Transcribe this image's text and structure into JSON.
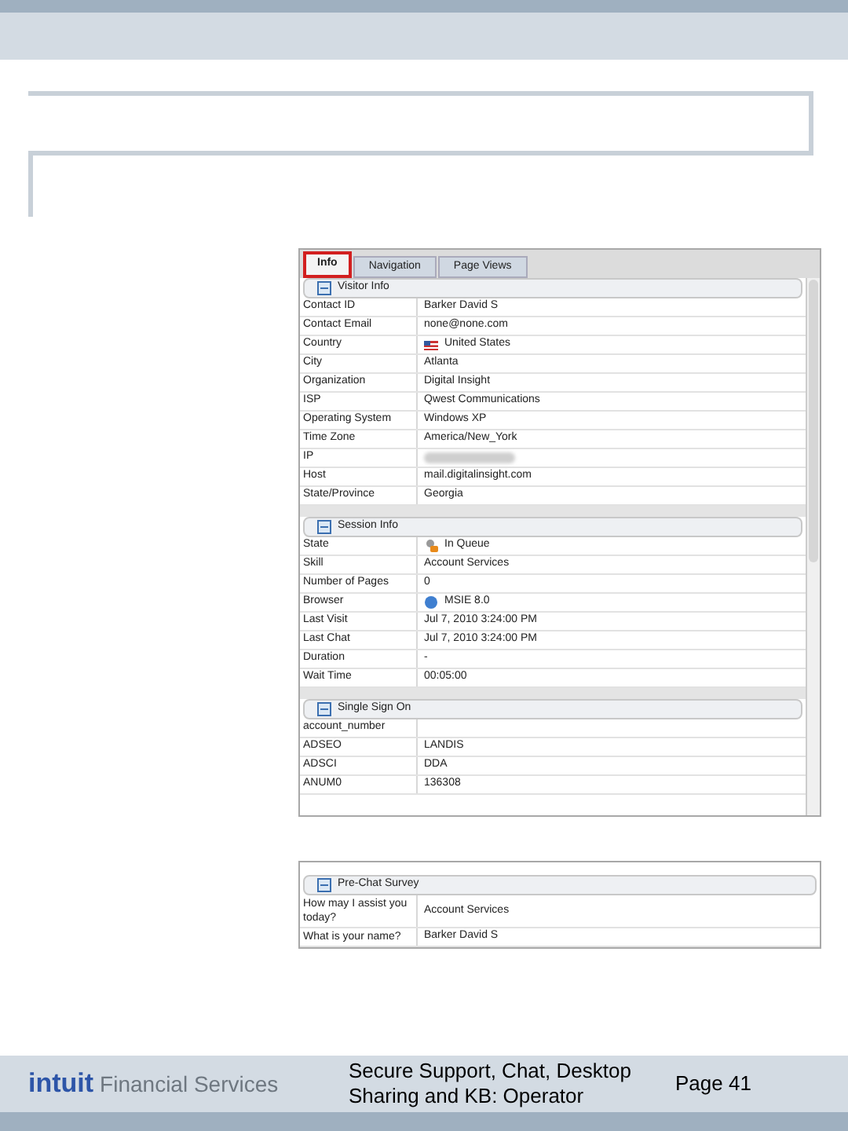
{
  "tabs": [
    {
      "label": "Info",
      "selected": true
    },
    {
      "label": "Navigation",
      "selected": false
    },
    {
      "label": "Page Views",
      "selected": false
    }
  ],
  "sections": [
    {
      "title": "Visitor Info",
      "rows": [
        {
          "label": "Contact ID",
          "kind": "text",
          "value": "Barker David S"
        },
        {
          "label": "Contact Email",
          "kind": "text",
          "value": "none@none.com"
        },
        {
          "label": "Country",
          "kind": "flag",
          "value": "United States"
        },
        {
          "label": "City",
          "kind": "text",
          "value": "Atlanta"
        },
        {
          "label": "Organization",
          "kind": "text",
          "value": "Digital Insight"
        },
        {
          "label": "ISP",
          "kind": "text",
          "value": "Qwest Communications"
        },
        {
          "label": "Operating System",
          "kind": "text",
          "value": "Windows XP"
        },
        {
          "label": "Time Zone",
          "kind": "text",
          "value": "America/New_York"
        },
        {
          "label": "IP",
          "kind": "blurred"
        },
        {
          "label": "Host",
          "kind": "text",
          "value": "mail.digitalinsight.com"
        },
        {
          "label": "State/Province",
          "kind": "text",
          "value": "Georgia"
        }
      ]
    },
    {
      "title": "Session Info",
      "rows": [
        {
          "label": "State",
          "kind": "state",
          "value": "In Queue"
        },
        {
          "label": "Skill",
          "kind": "text",
          "value": "Account Services"
        },
        {
          "label": "Number of Pages",
          "kind": "text",
          "value": "0"
        },
        {
          "label": "Browser",
          "kind": "browser",
          "value": "MSIE 8.0"
        },
        {
          "label": "Last Visit",
          "kind": "text",
          "value": "Jul 7, 2010 3:24:00 PM"
        },
        {
          "label": "Last Chat",
          "kind": "text",
          "value": "Jul 7, 2010 3:24:00 PM"
        },
        {
          "label": "Duration",
          "kind": "text",
          "value": "-"
        },
        {
          "label": "Wait Time",
          "kind": "text",
          "value": "00:05:00"
        }
      ]
    },
    {
      "title": "Single Sign On",
      "rows": [
        {
          "label": "account_number",
          "kind": "text",
          "value": ""
        },
        {
          "label": "ADSEO",
          "kind": "text",
          "value": "LANDIS"
        },
        {
          "label": "ADSCI",
          "kind": "text",
          "value": "DDA"
        },
        {
          "label": "ANUM0",
          "kind": "text",
          "value": "136308"
        }
      ]
    }
  ],
  "survey": {
    "title": "Pre-Chat Survey",
    "rows": [
      {
        "label": "How may I assist you today?",
        "value": "Account Services"
      },
      {
        "label": "What is your name?",
        "value": "Barker David S"
      }
    ]
  },
  "footer": {
    "brand": "intuit",
    "brand_suffix": "Financial Services",
    "title_lines": [
      "Secure Support, Chat, Desktop",
      "Sharing and KB: Operator"
    ],
    "page": "Page 41"
  }
}
